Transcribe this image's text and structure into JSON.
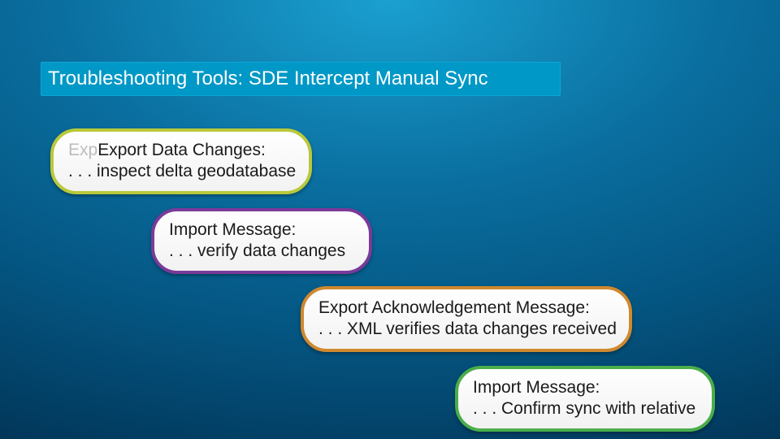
{
  "title": "Troubleshooting Tools: SDE Intercept Manual Sync",
  "steps": [
    {
      "prefix": "Exp",
      "line1": "Export Data Changes:",
      "line2": ". . . inspect delta geodatabase"
    },
    {
      "prefix": "",
      "line1": "Import Message:",
      "line2": ". . . verify data changes"
    },
    {
      "prefix": "",
      "line1": "Export Acknowledgement Message:",
      "line2": ". . . XML verifies data changes received"
    },
    {
      "prefix": "",
      "line1": "Import Message:",
      "line2": ". . . Confirm sync with relative"
    }
  ]
}
